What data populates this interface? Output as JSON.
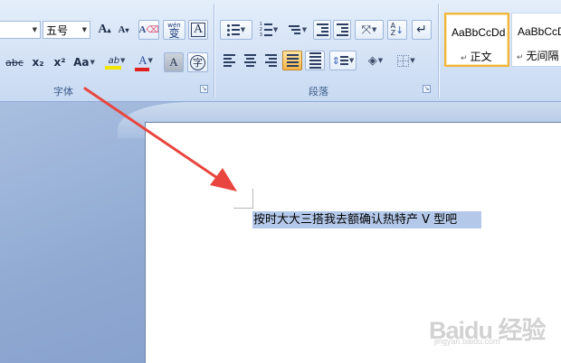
{
  "ribbon": {
    "font_group": {
      "label": "字体",
      "size_value": "五号",
      "grow_font": "A",
      "shrink_font": "A",
      "clear_format_glyph": "A",
      "phonetic_guide": "wén",
      "phonetic_char": "变",
      "char_border": "A",
      "strikethrough": "abc",
      "subscript": "x₂",
      "superscript": "x²",
      "change_case": "Aa",
      "highlight": "ab",
      "font_color": "A",
      "char_shading": "A",
      "enclose_char": "字"
    },
    "paragraph_group": {
      "label": "段落"
    },
    "styles_group": {
      "styles": [
        {
          "sample": "AaBbCcDd",
          "name": "正文",
          "selected": true
        },
        {
          "sample": "AaBbCcDd",
          "name": "无间隔",
          "selected": false
        }
      ]
    }
  },
  "document": {
    "selected_text": "按时大大三搭我去额确认热特产 V 型吧"
  },
  "watermark": {
    "brand": "Baidu 经验",
    "url": "jingyan.baidu.com"
  },
  "colors": {
    "highlight": "#f2e600",
    "font_color": "#e0201c",
    "arrow": "#e8463e",
    "selection": "#b4c9ea"
  }
}
